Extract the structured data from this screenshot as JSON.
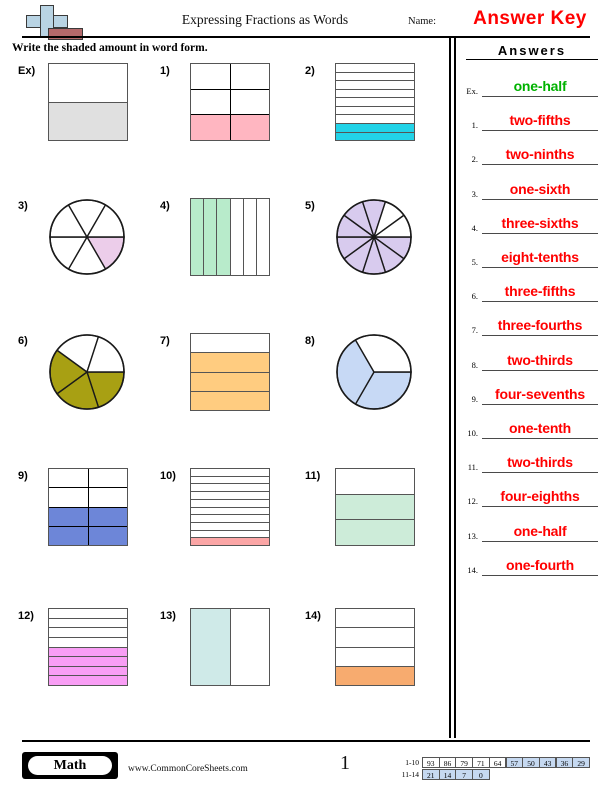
{
  "header": {
    "logo_icon": "plus-book-logo",
    "title": "Expressing Fractions as Words",
    "name_label": "Name:",
    "answer_key_label": "Answer Key",
    "instructions": "Write the shaded amount in word form."
  },
  "answers_panel": {
    "heading": "Answers",
    "accent_color": "#ff0000",
    "example_color": "#00b200",
    "rows": [
      {
        "num": "Ex.",
        "answer": "one-half",
        "is_example": true
      },
      {
        "num": "1.",
        "answer": "two-fifths",
        "is_example": false
      },
      {
        "num": "2.",
        "answer": "two-ninths",
        "is_example": false
      },
      {
        "num": "3.",
        "answer": "one-sixth",
        "is_example": false
      },
      {
        "num": "4.",
        "answer": "three-sixths",
        "is_example": false
      },
      {
        "num": "5.",
        "answer": "eight-tenths",
        "is_example": false
      },
      {
        "num": "6.",
        "answer": "three-fifths",
        "is_example": false
      },
      {
        "num": "7.",
        "answer": "three-fourths",
        "is_example": false
      },
      {
        "num": "8.",
        "answer": "two-thirds",
        "is_example": false
      },
      {
        "num": "9.",
        "answer": "four-sevenths",
        "is_example": false
      },
      {
        "num": "10.",
        "answer": "one-tenth",
        "is_example": false
      },
      {
        "num": "11.",
        "answer": "two-thirds",
        "is_example": false
      },
      {
        "num": "12.",
        "answer": "four-eighths",
        "is_example": false
      },
      {
        "num": "13.",
        "answer": "one-half",
        "is_example": false
      },
      {
        "num": "14.",
        "answer": "one-fourth",
        "is_example": false
      }
    ]
  },
  "problems": [
    {
      "label": "Ex)",
      "shape": "rows",
      "parts": 2,
      "shaded": 1,
      "shade_from": "bottom",
      "color": "#e0e0e0"
    },
    {
      "label": "1)",
      "shape": "grid",
      "cols": 2,
      "rows": 3,
      "shaded_rows": 1,
      "shade_from": "bottom",
      "color": "#ffb6c1"
    },
    {
      "label": "2)",
      "shape": "rows",
      "parts": 9,
      "shaded": 2,
      "shade_from": "bottom",
      "color": "#22d3e8"
    },
    {
      "label": "3)",
      "shape": "circle",
      "parts": 6,
      "shaded": 1,
      "color": "#eccdea"
    },
    {
      "label": "4)",
      "shape": "cols",
      "parts": 6,
      "shaded": 3,
      "shade_from": "left",
      "color": "#b8ebcb"
    },
    {
      "label": "5)",
      "shape": "circle",
      "parts": 10,
      "shaded": 8,
      "color": "#d8cbee"
    },
    {
      "label": "6)",
      "shape": "circle",
      "parts": 5,
      "shaded": 3,
      "color": "#a8a013"
    },
    {
      "label": "7)",
      "shape": "rows",
      "parts": 4,
      "shaded": 3,
      "shade_from": "bottom",
      "color": "#ffcc80"
    },
    {
      "label": "8)",
      "shape": "circle",
      "parts": 3,
      "shaded": 2,
      "color": "#c7d9f5"
    },
    {
      "label": "9)",
      "shape": "grid",
      "cols": 2,
      "rows": 4,
      "shaded_rows": 2,
      "shade_from": "bottom",
      "color": "#6d86d8"
    },
    {
      "label": "10)",
      "shape": "rows",
      "parts": 10,
      "shaded": 1,
      "shade_from": "bottom",
      "color": "#fba6a6"
    },
    {
      "label": "11)",
      "shape": "rows",
      "parts": 3,
      "shaded": 2,
      "shade_from": "bottom",
      "color": "#cdecd9"
    },
    {
      "label": "12)",
      "shape": "rows",
      "parts": 8,
      "shaded": 4,
      "shade_from": "bottom",
      "color": "#f99ef5"
    },
    {
      "label": "13)",
      "shape": "cols",
      "parts": 2,
      "shaded": 1,
      "shade_from": "left",
      "color": "#cfeae8"
    },
    {
      "label": "14)",
      "shape": "rows",
      "parts": 4,
      "shaded": 1,
      "shade_from": "bottom",
      "color": "#f7ab6f"
    }
  ],
  "footer": {
    "brand": "Math",
    "url": "www.CommonCoreSheets.com",
    "page_number": "1",
    "score_table": {
      "rows": [
        {
          "label": "1-10",
          "values": [
            "93",
            "86",
            "79",
            "71",
            "64",
            "57",
            "50",
            "43",
            "36",
            "29"
          ],
          "highlight": [
            false,
            false,
            false,
            false,
            false,
            true,
            true,
            true,
            true,
            true
          ]
        },
        {
          "label": "11-14",
          "values": [
            "21",
            "14",
            "7",
            "0"
          ],
          "highlight": [
            true,
            true,
            true,
            true
          ]
        }
      ]
    }
  }
}
